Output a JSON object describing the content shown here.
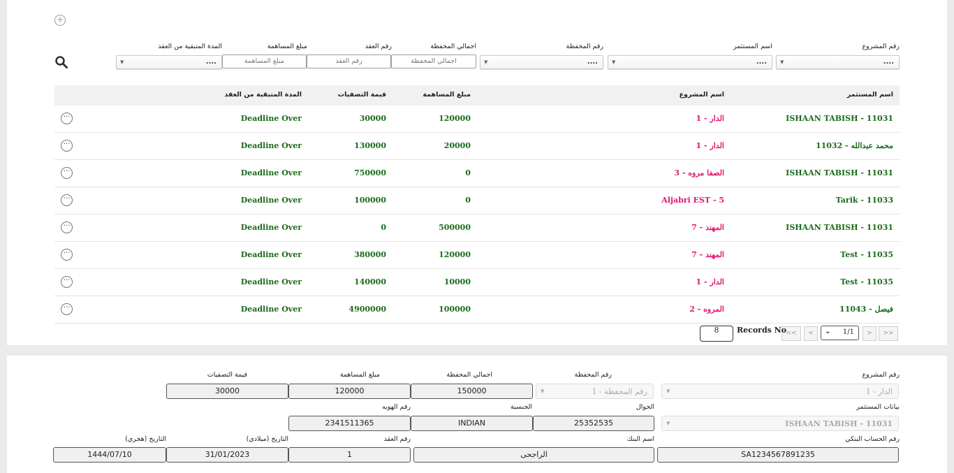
{
  "filters": {
    "project_number": {
      "label": "رقم المشروع",
      "value": "...."
    },
    "investor_name": {
      "label": "اسم المستثمر",
      "value": "...."
    },
    "portfolio_number": {
      "label": "رقم المحفظة",
      "value": "...."
    },
    "portfolio_total": {
      "label": "اجمالي المحفظة",
      "placeholder": "اجمالي المحفظة"
    },
    "contract_number": {
      "label": "رقم العقد",
      "placeholder": "رقم العقد"
    },
    "contribution_amount": {
      "label": "مبلغ المساهمة",
      "placeholder": "مبلغ المساهمة"
    },
    "remaining_period": {
      "label": "المدة المتبقية من العقد",
      "value": "...."
    }
  },
  "table": {
    "headers": {
      "investor": "اسم المستثمر",
      "project": "اسم المشروع",
      "contribution": "مبلغ المساهمة",
      "liquidation": "قيمة التصفيات",
      "remaining": "المدة المتبقية من العقد"
    },
    "rows": [
      {
        "investor": "ISHAAN TABISH - 11031",
        "project": "1 - الدار",
        "contribution": "120000",
        "liquidation": "30000",
        "remaining": "Deadline Over"
      },
      {
        "investor": "11032 - محمد عبدالله",
        "project": "1 - الدار",
        "contribution": "20000",
        "liquidation": "130000",
        "remaining": "Deadline Over"
      },
      {
        "investor": "ISHAAN TABISH - 11031",
        "project": "3 - الصفا مروه",
        "contribution": "0",
        "liquidation": "750000",
        "remaining": "Deadline Over"
      },
      {
        "investor": "Tarik - 11033",
        "project": "Aljabri EST - 5",
        "contribution": "0",
        "liquidation": "100000",
        "remaining": "Deadline Over"
      },
      {
        "investor": "ISHAAN TABISH - 11031",
        "project": "7 - المهند",
        "contribution": "500000",
        "liquidation": "0",
        "remaining": "Deadline Over"
      },
      {
        "investor": "Test - 11035",
        "project": "7 - المهند",
        "contribution": "120000",
        "liquidation": "380000",
        "remaining": "Deadline Over"
      },
      {
        "investor": "Test - 11035",
        "project": "1 - الدار",
        "contribution": "10000",
        "liquidation": "140000",
        "remaining": "Deadline Over"
      },
      {
        "investor": "11043 - فيصل",
        "project": "2 - المروه",
        "contribution": "100000",
        "liquidation": "4900000",
        "remaining": "Deadline Over"
      }
    ]
  },
  "pagination": {
    "first": "<<",
    "prev": "<",
    "page": "1/1",
    "next": ">",
    "last": ">>",
    "records_label": "Records No",
    "records_count": "8"
  },
  "detail": {
    "project_number": {
      "label": "رقم المشروع",
      "value": "1 - الدار"
    },
    "portfolio_number": {
      "label": "رقم المحفظة",
      "value": "رقم المحفظة - 1"
    },
    "portfolio_total": {
      "label": "اجمالي المحفظة",
      "value": "150000"
    },
    "contribution_amount": {
      "label": "مبلغ المساهمة",
      "value": "120000"
    },
    "liquidation_value": {
      "label": "قيمة التصفيات",
      "value": "30000"
    },
    "investor_data": {
      "label": "بيانات المستثمر",
      "value": "ISHAAN TABISH - 11031"
    },
    "mobile": {
      "label": "الجوال",
      "value": "25352535"
    },
    "nationality": {
      "label": "الجنسية",
      "value": "INDIAN"
    },
    "id_number": {
      "label": "رقم الهويه",
      "value": "2341511365"
    },
    "bank_account": {
      "label": "رقم الحساب البنكي",
      "value": "SA1234567891235"
    },
    "bank_name": {
      "label": "اسم البنك",
      "value": "الراجحى"
    },
    "contract_number": {
      "label": "رقم العقد",
      "value": "1"
    },
    "date_gregorian": {
      "label": "التاريخ (ميلادي)",
      "value": "31/01/2023"
    },
    "date_hijri": {
      "label": "التاريخ (هجري)",
      "value": "1444/07/10"
    }
  }
}
